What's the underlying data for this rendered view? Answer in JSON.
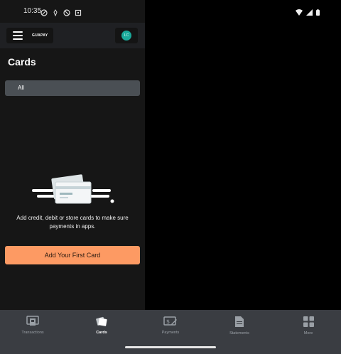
{
  "status": {
    "time": "10:35"
  },
  "header": {
    "brand": "GUAPAY",
    "avatar_initials": "LC"
  },
  "page": {
    "title": "Cards"
  },
  "filter": {
    "selected": "All"
  },
  "empty_state": {
    "message": "Add credit, debit or store cards to make sure payments in apps.",
    "cta_label": "Add Your First Card"
  },
  "bottom_nav": [
    {
      "label": "Transactions",
      "icon": "transactions-icon"
    },
    {
      "label": "Cards",
      "icon": "cards-icon"
    },
    {
      "label": "Payments",
      "icon": "payments-icon"
    },
    {
      "label": "Statements",
      "icon": "statements-icon"
    },
    {
      "label": "More",
      "icon": "more-grid-icon"
    }
  ],
  "colors": {
    "accent": "#fd9a63",
    "avatar": "#1aa99a",
    "nav_bg": "#3a3d42",
    "filter_bg": "#4a4f54"
  }
}
